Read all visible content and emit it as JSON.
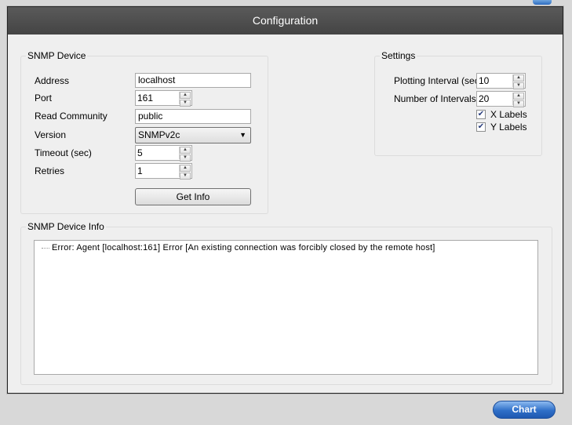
{
  "window": {
    "title": "Configuration"
  },
  "snmp_device": {
    "title": "SNMP Device",
    "address_label": "Address",
    "address_value": "localhost",
    "port_label": "Port",
    "port_value": "161",
    "community_label": "Read Community",
    "community_value": "public",
    "version_label": "Version",
    "version_value": "SNMPv2c",
    "timeout_label": "Timeout (sec)",
    "timeout_value": "5",
    "retries_label": "Retries",
    "retries_value": "1",
    "get_info_label": "Get Info"
  },
  "settings": {
    "title": "Settings",
    "plot_interval_label": "Plotting Interval (sec)",
    "plot_interval_value": "10",
    "num_intervals_label": "Number of Intervals",
    "num_intervals_value": "20",
    "x_labels_label": "X Labels",
    "x_labels_checked": true,
    "y_labels_label": "Y Labels",
    "y_labels_checked": true
  },
  "device_info": {
    "title": "SNMP Device Info",
    "items": [
      {
        "text": "Error:  Agent [localhost:161] Error [An existing connection was forcibly closed by the remote host]"
      }
    ]
  },
  "footer": {
    "chart_label": "Chart"
  },
  "icons": {
    "check": "checkmark-icon",
    "spin": "spin-arrows-icon",
    "dropdown": "chevron-down-icon"
  }
}
